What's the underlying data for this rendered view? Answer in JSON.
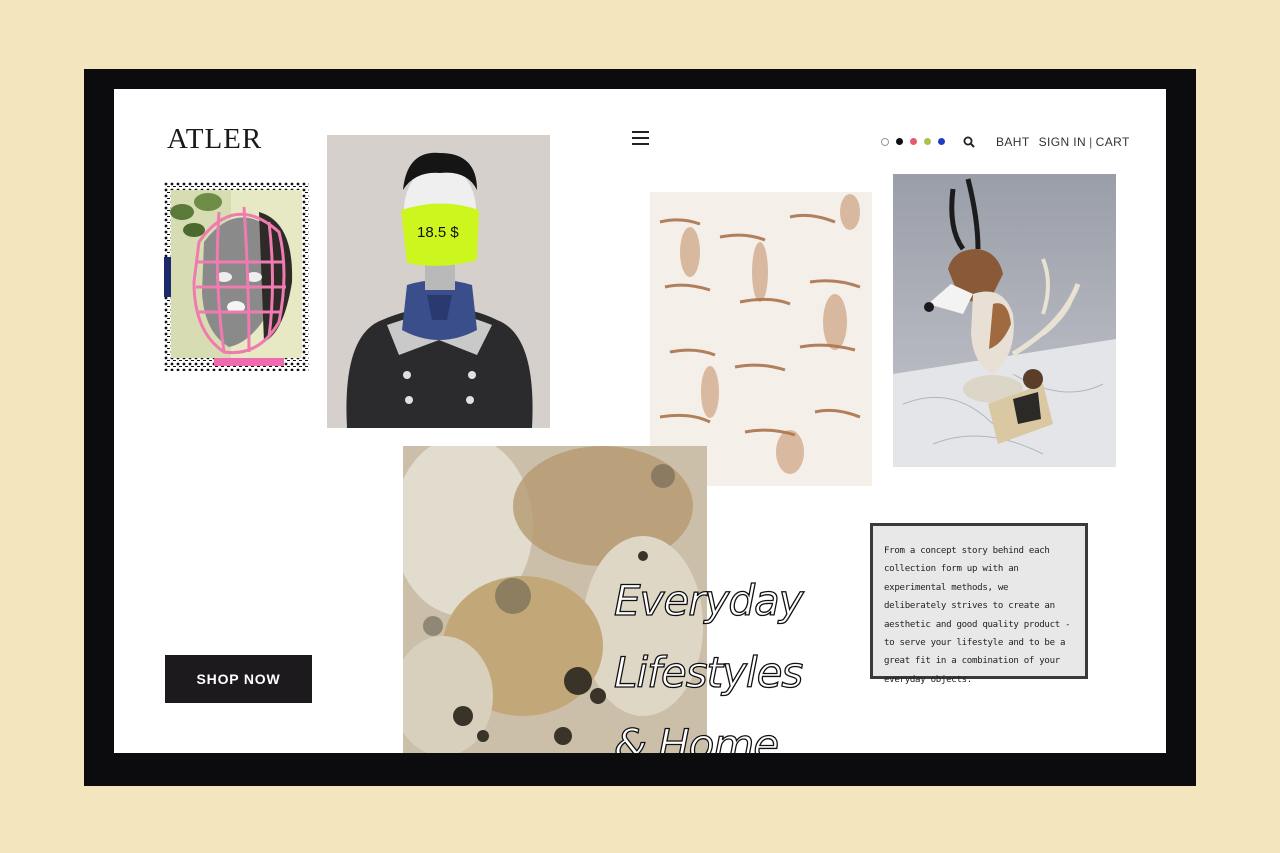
{
  "brand": {
    "logo": "ATLER"
  },
  "header": {
    "swatches": [
      {
        "name": "white",
        "color": "#ffffff"
      },
      {
        "name": "black",
        "color": "#111111"
      },
      {
        "name": "pink",
        "color": "#e65a70"
      },
      {
        "name": "lime",
        "color": "#a9c34a"
      },
      {
        "name": "blue",
        "color": "#1f3fbf"
      }
    ],
    "currency": "BAHT",
    "sign_in": "SIGN IN",
    "separator": "|",
    "cart": "CART"
  },
  "products": {
    "price_tag": "18.5 $"
  },
  "hero": {
    "tagline_line1": "Everyday",
    "tagline_line2": "Lifestyles",
    "tagline_line3": "& Home",
    "description": "From a concept story behind each collection form up with an experimental methods, we deliberately strives to create an aesthetic and good quality product - to serve your lifestyle and to be a great fit in a combination of your everyday objects.",
    "cta_label": "SHOP NOW"
  },
  "colors": {
    "page_background": "#f3e5bd",
    "frame": "#0c0b0d",
    "price_tag": "#cdf51e",
    "button": "#1c1a1c"
  }
}
